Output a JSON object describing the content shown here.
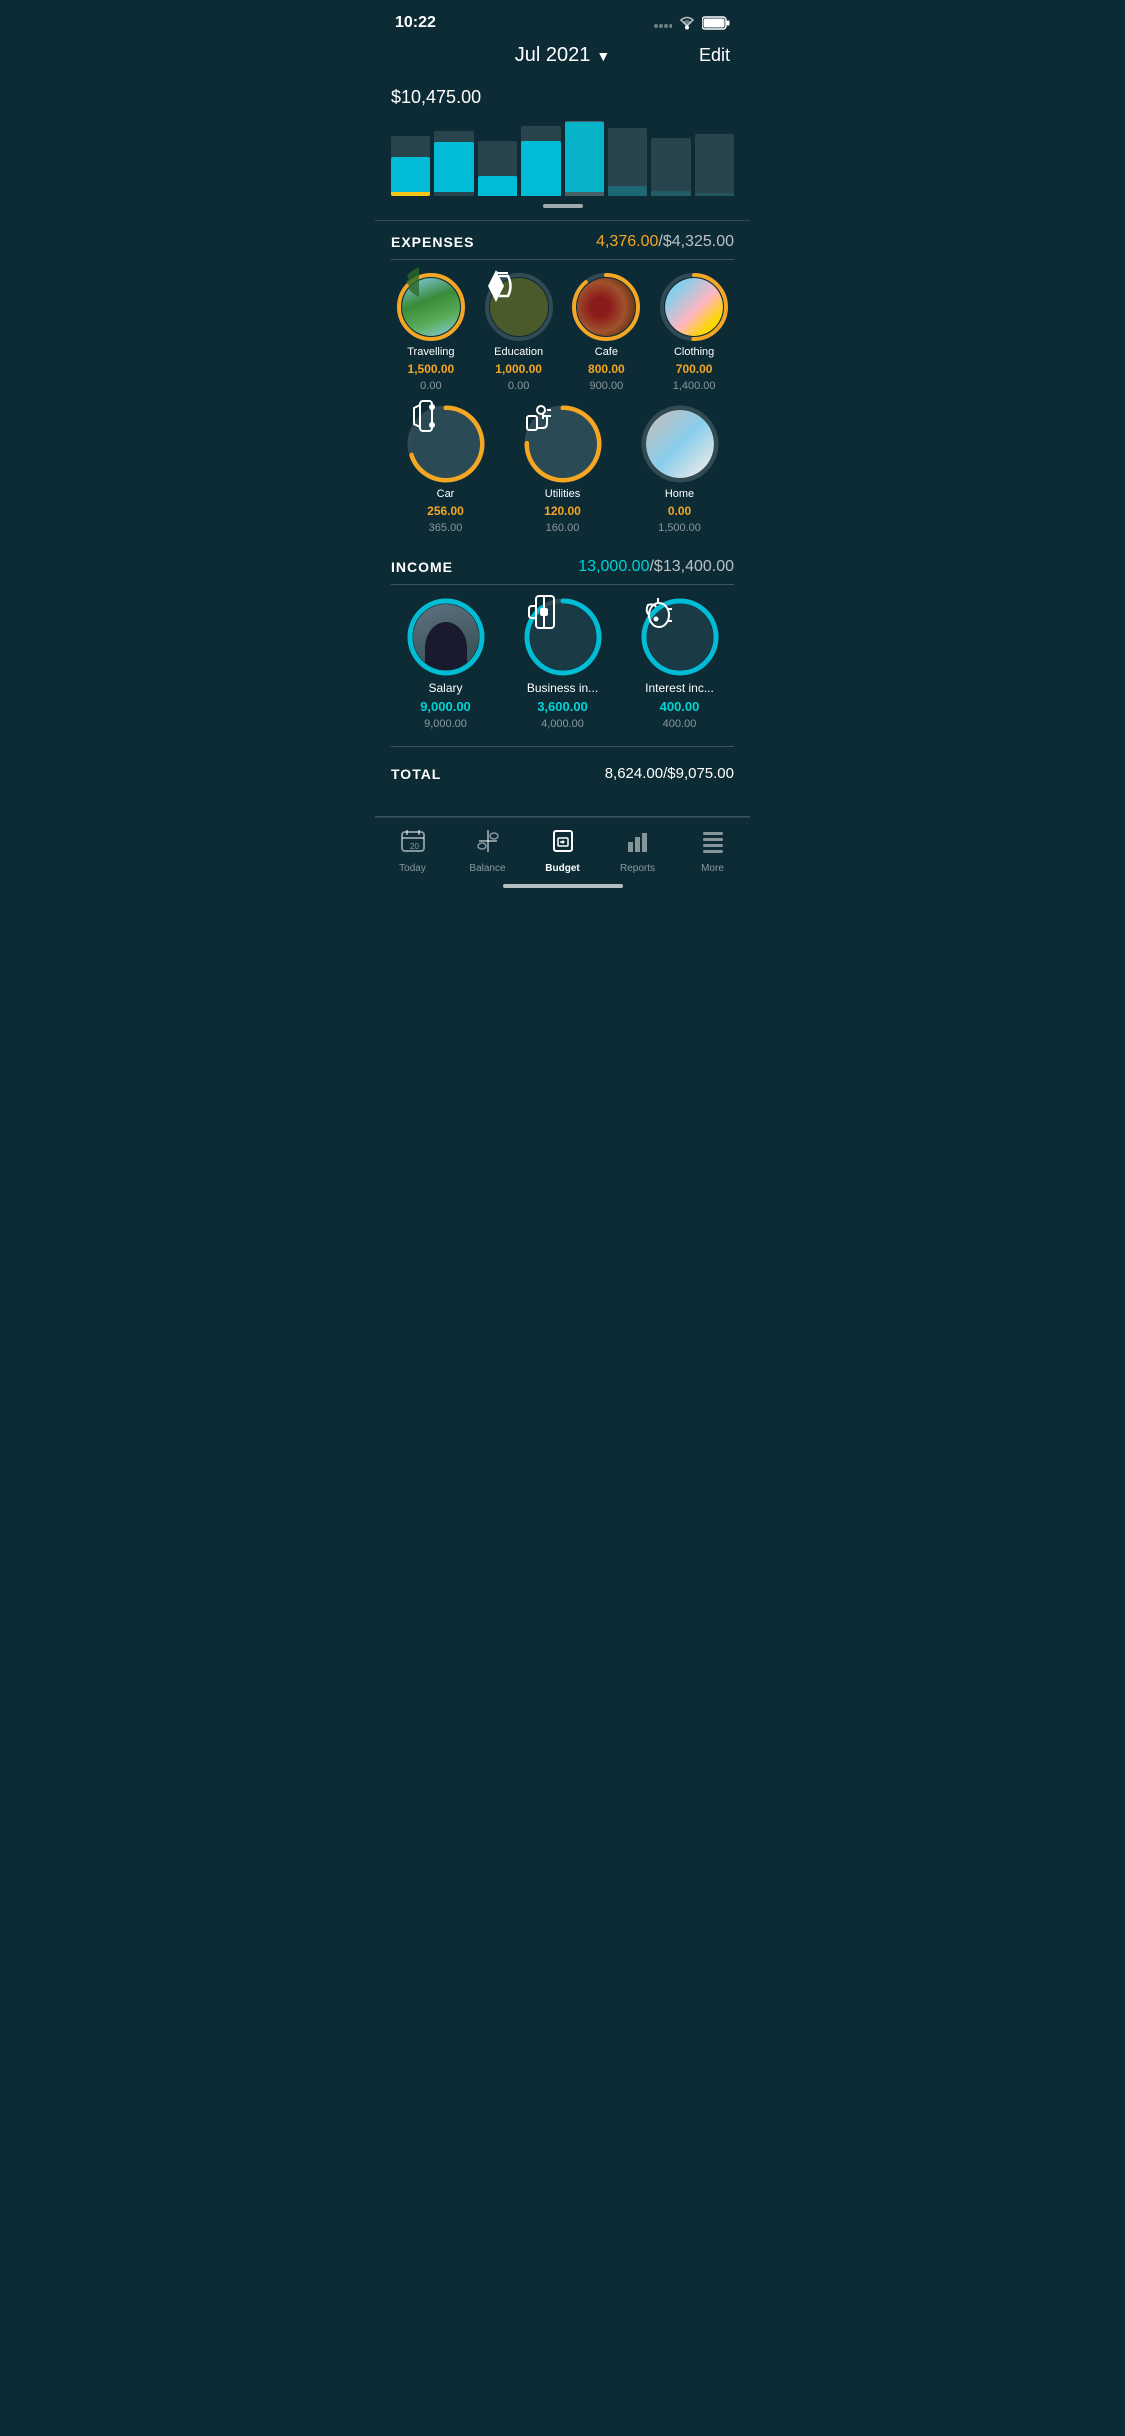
{
  "statusBar": {
    "time": "10:22"
  },
  "header": {
    "title": "Jul 2021",
    "chevron": "▼",
    "editLabel": "Edit"
  },
  "chart": {
    "totalAmount": "$10,475.00"
  },
  "expenses": {
    "sectionTitle": "EXPENSES",
    "spent": "4,376.00",
    "budget": "$4,325.00",
    "categories": [
      {
        "name": "Travelling",
        "spent": "1,500.00",
        "budget": "0.00",
        "type": "photo-travelling",
        "pct": 100
      },
      {
        "name": "Education",
        "spent": "1,000.00",
        "budget": "0.00",
        "type": "icon-education",
        "pct": 0
      },
      {
        "name": "Cafe",
        "spent": "800.00",
        "budget": "900.00",
        "type": "photo-cafe",
        "pct": 89
      },
      {
        "name": "Clothing",
        "spent": "700.00",
        "budget": "1,400.00",
        "type": "photo-clothing",
        "pct": 50
      },
      {
        "name": "Car",
        "spent": "256.00",
        "budget": "365.00",
        "type": "icon-car",
        "pct": 70
      },
      {
        "name": "Utilities",
        "spent": "120.00",
        "budget": "160.00",
        "type": "icon-utilities",
        "pct": 75
      },
      {
        "name": "Home",
        "spent": "0.00",
        "budget": "1,500.00",
        "type": "photo-home",
        "pct": 0
      }
    ]
  },
  "income": {
    "sectionTitle": "INCOME",
    "earned": "13,000.00",
    "budget": "$13,400.00",
    "items": [
      {
        "name": "Salary",
        "earned": "9,000.00",
        "budget": "9,000.00",
        "type": "photo-salary",
        "pct": 100
      },
      {
        "name": "Business in...",
        "earned": "3,600.00",
        "budget": "4,000.00",
        "type": "icon-business",
        "pct": 90
      },
      {
        "name": "Interest inc...",
        "earned": "400.00",
        "budget": "400.00",
        "type": "icon-interest",
        "pct": 100
      }
    ]
  },
  "total": {
    "label": "TOTAL",
    "amount": "8,624.00",
    "budget": "$9,075.00"
  },
  "tabBar": {
    "items": [
      {
        "id": "today",
        "label": "Today",
        "icon": "today"
      },
      {
        "id": "balance",
        "label": "Balance",
        "icon": "balance"
      },
      {
        "id": "budget",
        "label": "Budget",
        "icon": "budget",
        "active": true
      },
      {
        "id": "reports",
        "label": "Reports",
        "icon": "reports"
      },
      {
        "id": "more",
        "label": "More",
        "icon": "more"
      }
    ]
  }
}
